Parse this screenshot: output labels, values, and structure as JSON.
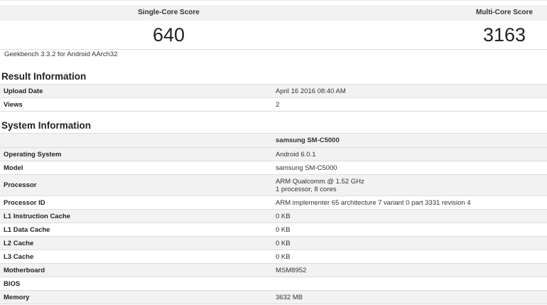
{
  "scores": {
    "single_label": "Single-Core Score",
    "single_value": "640",
    "multi_label": "Multi-Core Score",
    "multi_value": "3163"
  },
  "version": "Geekbench 3.3.2 for Android AArch32",
  "result_info": {
    "title": "Result Information",
    "rows": [
      {
        "key": "Upload Date",
        "value": "April 16 2016 08:40 AM"
      },
      {
        "key": "Views",
        "value": "2"
      }
    ]
  },
  "system_info": {
    "title": "System Information",
    "device_header": "samsung SM-C5000",
    "rows": [
      {
        "key": "Operating System",
        "value": "Android 6.0.1"
      },
      {
        "key": "Model",
        "value": "samsung SM-C5000"
      },
      {
        "key": "Processor",
        "value": "ARM Qualcomm @ 1.52 GHz",
        "value2": "1 processor, 8 cores"
      },
      {
        "key": "Processor ID",
        "value": "ARM implementer 65 architecture 7 variant 0 part 3331 revision 4"
      },
      {
        "key": "L1 Instruction Cache",
        "value": "0 KB"
      },
      {
        "key": "L1 Data Cache",
        "value": "0 KB"
      },
      {
        "key": "L2 Cache",
        "value": "0 KB"
      },
      {
        "key": "L3 Cache",
        "value": "0 KB"
      },
      {
        "key": "Motherboard",
        "value": "MSM8952"
      },
      {
        "key": "BIOS",
        "value": ""
      },
      {
        "key": "Memory",
        "value": "3632 MB"
      }
    ]
  }
}
